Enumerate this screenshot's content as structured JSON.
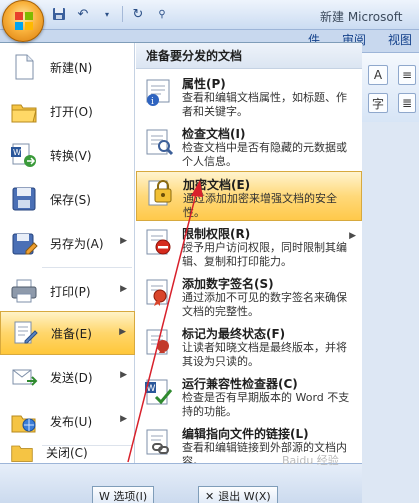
{
  "title_bar": {
    "document_title": "新建 Microsoft",
    "qat": [
      "save-icon",
      "undo-icon",
      "redo-icon",
      "customize-icon"
    ]
  },
  "ribbon": {
    "tabs": [
      "件",
      "审阅",
      "视图"
    ],
    "buttons": [
      "A",
      "字"
    ]
  },
  "left_menu": [
    {
      "key": "new",
      "label": "新建(N)",
      "icon": "new-document-icon",
      "submenu": false
    },
    {
      "key": "open",
      "label": "打开(O)",
      "icon": "open-folder-icon",
      "submenu": false
    },
    {
      "key": "convert",
      "label": "转换(V)",
      "icon": "convert-icon",
      "submenu": false
    },
    {
      "key": "save",
      "label": "保存(S)",
      "icon": "save-disk-icon",
      "submenu": false
    },
    {
      "key": "save_as",
      "label": "另存为(A)",
      "icon": "save-as-icon",
      "submenu": true
    },
    {
      "key": "print",
      "label": "打印(P)",
      "icon": "printer-icon",
      "submenu": true
    },
    {
      "key": "prepare",
      "label": "准备(E)",
      "icon": "prepare-icon",
      "submenu": true,
      "active": true
    },
    {
      "key": "send",
      "label": "发送(D)",
      "icon": "send-icon",
      "submenu": true
    },
    {
      "key": "publish",
      "label": "发布(U)",
      "icon": "publish-icon",
      "submenu": true
    },
    {
      "key": "close",
      "label": "关闭(C)",
      "icon": "close-folder-icon",
      "submenu": false
    }
  ],
  "right_pane": {
    "header": "准备要分发的文档",
    "options": [
      {
        "key": "properties",
        "title": "属性(P)",
        "desc": "查看和编辑文档属性，如标题、作者和关键字。",
        "icon": "properties-icon",
        "submenu": false
      },
      {
        "key": "inspect",
        "title": "检查文档(I)",
        "desc": "检查文档中是否有隐藏的元数据或个人信息。",
        "icon": "inspect-document-icon",
        "submenu": false
      },
      {
        "key": "encrypt",
        "title": "加密文档(E)",
        "desc": "通过添加加密来增强文档的安全性。",
        "icon": "encrypt-lock-icon",
        "submenu": false,
        "active": true
      },
      {
        "key": "restrict",
        "title": "限制权限(R)",
        "desc": "授予用户访问权限，同时限制其编辑、复制和打印能力。",
        "icon": "restrict-permission-icon",
        "submenu": true
      },
      {
        "key": "signature",
        "title": "添加数字签名(S)",
        "desc": "通过添加不可见的数字签名来确保文档的完整性。",
        "icon": "digital-signature-icon",
        "submenu": false
      },
      {
        "key": "final",
        "title": "标记为最终状态(F)",
        "desc": "让读者知晓文档是最终版本，并将其设为只读的。",
        "icon": "mark-final-icon",
        "submenu": false
      },
      {
        "key": "compat",
        "title": "运行兼容性检查器(C)",
        "desc": "检查是否有早期版本的 Word 不支持的功能。",
        "icon": "compatibility-checker-icon",
        "submenu": false
      },
      {
        "key": "links",
        "title": "编辑指向文件的链接(L)",
        "desc": "查看和编辑链接到外部源的文档内容。",
        "icon": "edit-links-icon",
        "submenu": false
      }
    ]
  },
  "bottom_bar": {
    "options_label": "W 选项(I)",
    "exit_label": "退出 W(X)"
  },
  "watermark": "Baidu 经验",
  "colors": {
    "highlight": "#ffd66b",
    "annotation_arrow": "#d8202b",
    "menu_border": "#7f9db9"
  }
}
